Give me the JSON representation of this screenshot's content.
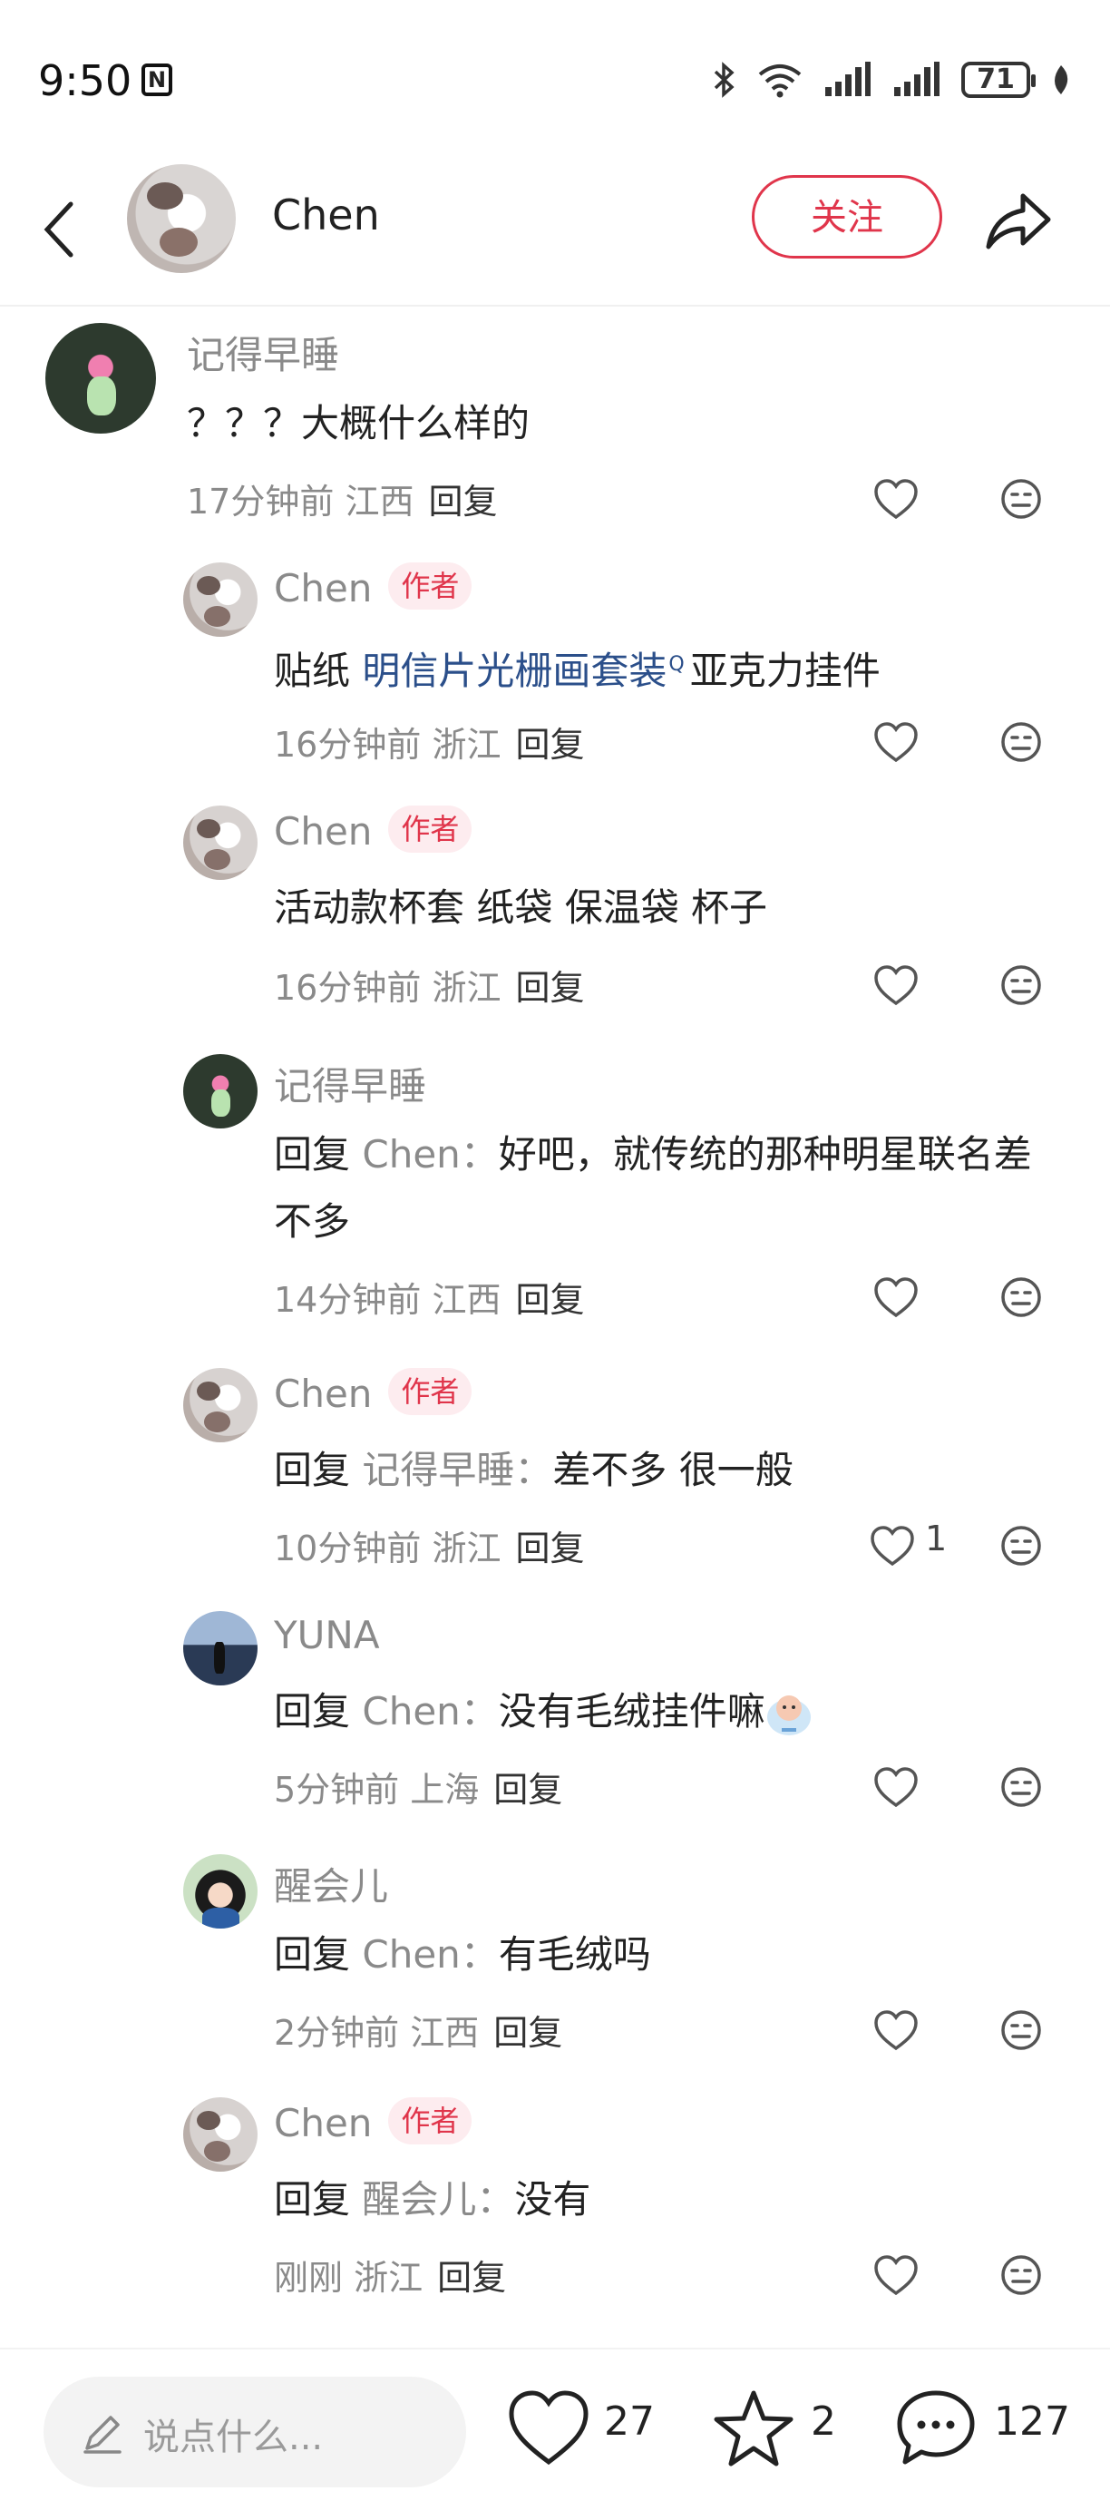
{
  "status": {
    "time": "9:50",
    "battery": "71"
  },
  "header": {
    "name": "Chen",
    "follow_label": "关注"
  },
  "comments": [
    {
      "user": "记得早睡",
      "author": false,
      "text": "？？？大概什么样的",
      "time": "17分钟前",
      "location": "江西",
      "reply_label": "回复",
      "likes": ""
    },
    {
      "user": "Chen",
      "author": true,
      "author_tag": "作者",
      "pre": "贴纸 ",
      "link": "明信片光栅画套装",
      "post": "亚克力挂件",
      "time": "16分钟前",
      "location": "浙江",
      "reply_label": "回复",
      "likes": ""
    },
    {
      "user": "Chen",
      "author": true,
      "author_tag": "作者",
      "text": "活动款杯套 纸袋 保温袋 杯子",
      "time": "16分钟前",
      "location": "浙江",
      "reply_label": "回复",
      "likes": ""
    },
    {
      "user": "记得早睡",
      "author": false,
      "reply_pre": "回复",
      "reply_target": "Chen：",
      "text": "好吧，就传统的那种明星联名差不多",
      "time": "14分钟前",
      "location": "江西",
      "reply_label": "回复",
      "likes": ""
    },
    {
      "user": "Chen",
      "author": true,
      "author_tag": "作者",
      "reply_pre": "回复",
      "reply_target": "记得早睡：",
      "text": "差不多 很一般",
      "time": "10分钟前",
      "location": "浙江",
      "reply_label": "回复",
      "likes": "1"
    },
    {
      "user": "YUNA",
      "author": false,
      "reply_pre": "回复",
      "reply_target": "Chen：",
      "text": "没有毛绒挂件嘛",
      "time": "5分钟前",
      "location": "上海",
      "reply_label": "回复",
      "likes": ""
    },
    {
      "user": "醒会儿",
      "author": false,
      "reply_pre": "回复",
      "reply_target": "Chen：",
      "text": "有毛绒吗",
      "time": "2分钟前",
      "location": "江西",
      "reply_label": "回复",
      "likes": ""
    },
    {
      "user": "Chen",
      "author": true,
      "author_tag": "作者",
      "reply_pre": "回复",
      "reply_target": "醒会儿：",
      "text": "没有",
      "time": "刚刚",
      "location": "浙江",
      "reply_label": "回复",
      "likes": ""
    }
  ],
  "bottom": {
    "placeholder": "说点什么...",
    "likes": "27",
    "stars": "2",
    "comments": "127"
  }
}
